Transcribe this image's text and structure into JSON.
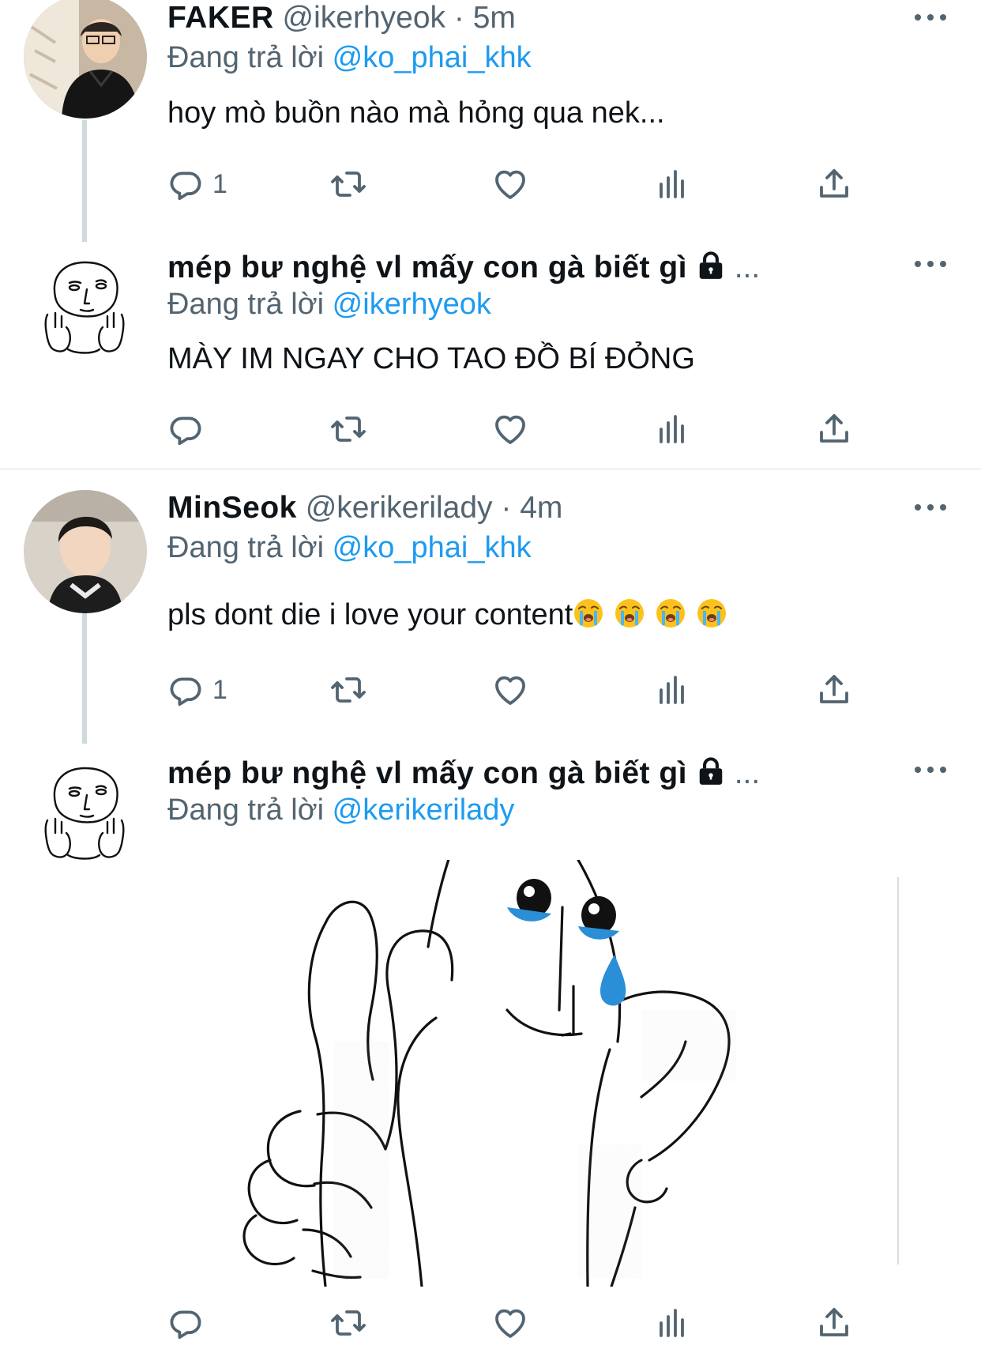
{
  "tweets": [
    {
      "name": "FAKER",
      "handle": "@ikerhyeok",
      "separator": "·",
      "time": "5m",
      "reply_prefix": "Đang trả lời",
      "reply_to": "@ko_phai_khk",
      "text": "hoy mò buồn nào mà hỏng qua nek...",
      "reply_count": "1"
    },
    {
      "name": "mép bư nghệ vl mấy con gà biết gì",
      "protected_suffix": "...",
      "reply_prefix": "Đang trả lời",
      "reply_to": "@ikerhyeok",
      "text": "MÀY IM NGAY CHO TAO ĐỒ BÍ ĐỎNG"
    },
    {
      "name": "MinSeok",
      "handle": "@kerikerilady",
      "separator": "·",
      "time": "4m",
      "reply_prefix": "Đang trả lời",
      "reply_to": "@ko_phai_khk",
      "text": "pls dont die i love your content",
      "reply_count": "1"
    },
    {
      "name": "mép bư nghệ vl mấy con gà biết gì",
      "protected_suffix": "...",
      "reply_prefix": "Đang trả lời",
      "reply_to": "@kerikerilady"
    }
  ],
  "icons": {
    "reply": "reply-icon",
    "retweet": "retweet-icon",
    "like": "heart-icon",
    "analytics": "analytics-icon",
    "share": "share-icon",
    "more": "more-icon",
    "lock": "lock-icon",
    "emoji": "loudly-crying-face-emoji"
  },
  "colors": {
    "link": "#1d9bf0",
    "secondary_text": "#536471",
    "thread_line": "#cfd9de",
    "divider": "#eff3f4",
    "tear": "#2b8fd8"
  }
}
